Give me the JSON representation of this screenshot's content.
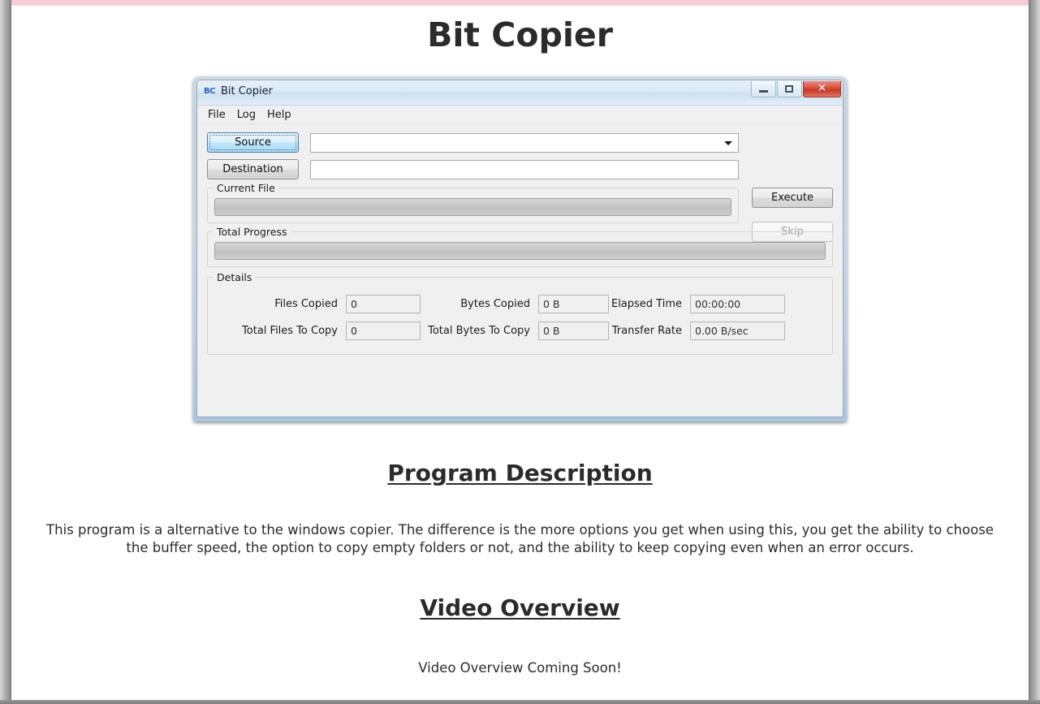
{
  "page": {
    "title": "Bit Copier",
    "sections": {
      "program_description_heading": "Program Description",
      "program_description_body": "This program is a alternative to the windows copier. The difference is the more options you get when using this, you get the ability to choose the buffer speed, the option to copy empty folders or not, and the ability to keep copying even when an error occurs.",
      "video_overview_heading": "Video Overview",
      "video_overview_note": "Video Overview Coming Soon!"
    },
    "accent_pink": "#f6cdd4",
    "text_color": "#2b2b2b"
  },
  "app_window": {
    "icon_label": "BC",
    "title": "Bit Copier",
    "window_controls": {
      "minimize": "minimize-button",
      "maximize": "maximize-button",
      "close_glyph": "✕",
      "close_color": "#c23823"
    },
    "menu": [
      {
        "label": "File"
      },
      {
        "label": "Log"
      },
      {
        "label": "Help"
      }
    ],
    "paths": {
      "source_button": "Source",
      "source_value": "",
      "source_placeholder": "",
      "destination_button": "Destination",
      "destination_value": "",
      "destination_placeholder": ""
    },
    "actions": {
      "execute_label": "Execute",
      "skip_label": "Skip",
      "skip_disabled": true
    },
    "progress": {
      "current_file_legend": "Current File",
      "current_file_percent": 0,
      "total_progress_legend": "Total Progress",
      "total_progress_percent": 0
    },
    "details": {
      "legend": "Details",
      "fields": [
        {
          "label": "Files Copied",
          "value": "0"
        },
        {
          "label": "Bytes Copied",
          "value": "0 B"
        },
        {
          "label": "Elapsed Time",
          "value": "00:00:00"
        },
        {
          "label": "Total Files To Copy",
          "value": "0"
        },
        {
          "label": "Total Bytes To Copy",
          "value": "0 B"
        },
        {
          "label": "Transfer Rate",
          "value": "0.00 B/sec"
        }
      ]
    }
  }
}
